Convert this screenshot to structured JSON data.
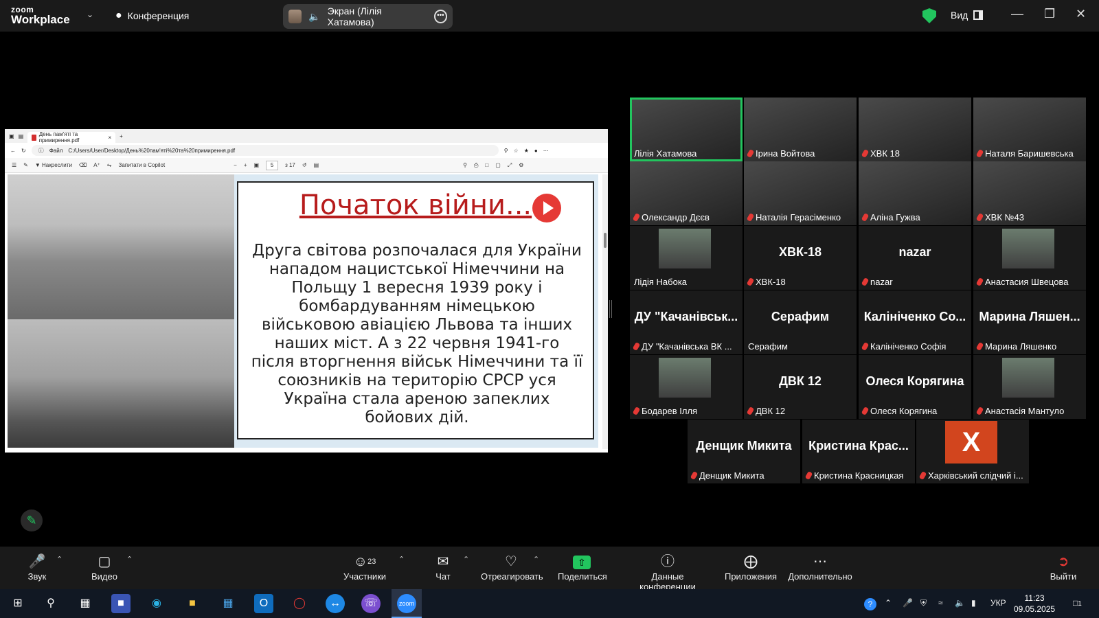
{
  "app": {
    "brand_line1": "zoom",
    "brand_line2": "Workplace",
    "meeting_label": "Конференция",
    "share_indicator": "Экран (Лілія Хатамова)",
    "view_label": "Вид"
  },
  "browser": {
    "tab_title": "День пам'яті та примирення.pdf",
    "file_label": "Файл",
    "url": "C:/Users/User/Desktop/День%20пам'яті%20та%20примирення.pdf",
    "toolbar": {
      "draw_label": "Накреслити",
      "copilot_label": "Запитати в Copilot",
      "page_current": "5",
      "page_total": "з 17"
    }
  },
  "slide": {
    "title": "Початок війни...",
    "body": "Друга світова розпочалася для України нападом нацистської Німеччини на Польщу 1 вересня 1939 року і бомбардуванням німецькою військовою авіацією Львова та інших наших міст. А з 22 червня 1941-го після вторгнення військ Німеччини та її союзників на територію СРСР уся Україна стала ареною запеклих бойових дій."
  },
  "participants": [
    {
      "name": "Лілія Хатамова",
      "muted": false,
      "video": true,
      "active": true
    },
    {
      "name": "Ірина Войтова",
      "muted": true,
      "video": true
    },
    {
      "name": "ХВК 18",
      "muted": true,
      "video": true
    },
    {
      "name": "Наталя Баришевська",
      "muted": true,
      "video": true
    },
    {
      "name": "Олександр Дєєв",
      "muted": true,
      "video": true
    },
    {
      "name": "Наталія Герасіменко",
      "muted": true,
      "video": true
    },
    {
      "name": "Аліна Гужва",
      "muted": true,
      "video": true
    },
    {
      "name": "ХВК №43",
      "muted": true,
      "video": true
    },
    {
      "name": "Лідія Набока",
      "muted": false,
      "avatar": true
    },
    {
      "name": "ХВК-18",
      "big": "ХВК-18",
      "muted": true
    },
    {
      "name": "nazar",
      "big": "nazar",
      "muted": true
    },
    {
      "name": "Анастасия Швецова",
      "muted": true,
      "avatar": true
    },
    {
      "name": "ДУ \"Качанівська ВК ...",
      "big": "ДУ  \"Качанівськ...",
      "muted": true
    },
    {
      "name": "Серафим",
      "big": "Серафим",
      "muted": false
    },
    {
      "name": "Калініченко Софія",
      "big": "Калініченко Со...",
      "muted": true
    },
    {
      "name": "Марина Ляшенко",
      "big": "Марина  Ляшен...",
      "muted": true
    },
    {
      "name": "Бодарев Ілля",
      "muted": true,
      "avatar": true
    },
    {
      "name": "ДВК 12",
      "big": "ДВК 12",
      "muted": true
    },
    {
      "name": "Олеся Корягина",
      "big": "Олеся Корягина",
      "muted": true
    },
    {
      "name": "Анастасія Мантуло",
      "muted": true,
      "avatar": true
    },
    {
      "name": "Денщик Микита",
      "big": "Денщик Микита",
      "muted": true
    },
    {
      "name": "Кристина Красницкая",
      "big": "Кристина  Крас...",
      "muted": true
    },
    {
      "name": "Харківський слідчий і...",
      "muted": true,
      "avatar_letter": "X"
    }
  ],
  "toolbar": {
    "audio": "Звук",
    "video": "Видео",
    "participants": "Участники",
    "participants_count": "23",
    "chat": "Чат",
    "react": "Отреагировать",
    "share": "Поделиться",
    "info": "Данные конференции",
    "apps": "Приложения",
    "more": "Дополнительно",
    "leave": "Выйти"
  },
  "taskbar": {
    "lang": "УКР",
    "time": "11:23",
    "date": "09.05.2025",
    "notifications": "1"
  }
}
